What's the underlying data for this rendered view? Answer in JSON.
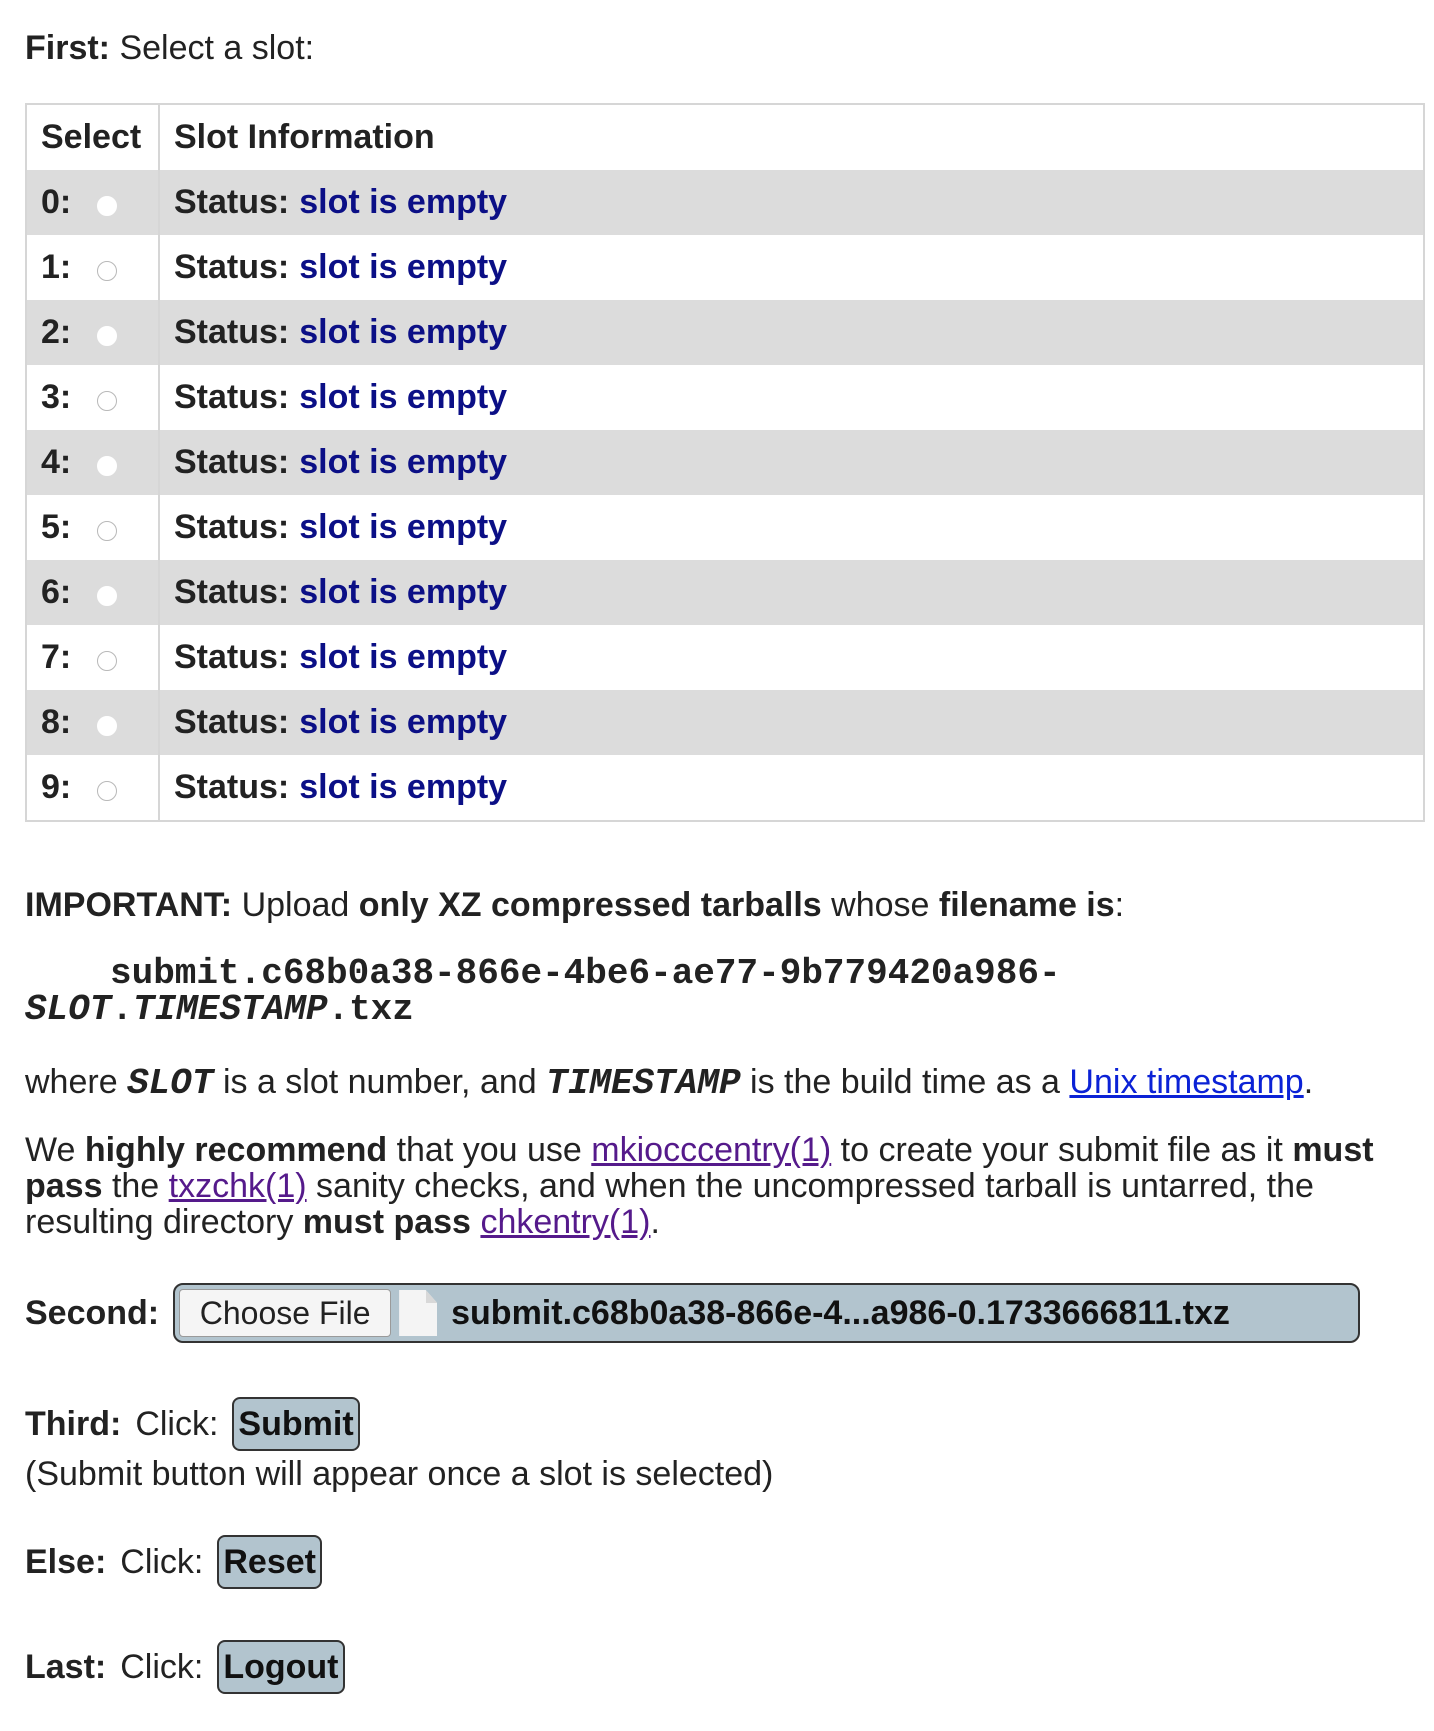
{
  "first": {
    "label": "First:",
    "text": "Select a slot:"
  },
  "table": {
    "headers": [
      "Select",
      "Slot Information"
    ],
    "status_label": "Status:",
    "rows": [
      {
        "num": "0:",
        "status": "slot is empty",
        "selected": true
      },
      {
        "num": "1:",
        "status": "slot is empty",
        "selected": false
      },
      {
        "num": "2:",
        "status": "slot is empty",
        "selected": false
      },
      {
        "num": "3:",
        "status": "slot is empty",
        "selected": false
      },
      {
        "num": "4:",
        "status": "slot is empty",
        "selected": false
      },
      {
        "num": "5:",
        "status": "slot is empty",
        "selected": false
      },
      {
        "num": "6:",
        "status": "slot is empty",
        "selected": false
      },
      {
        "num": "7:",
        "status": "slot is empty",
        "selected": false
      },
      {
        "num": "8:",
        "status": "slot is empty",
        "selected": false
      },
      {
        "num": "9:",
        "status": "slot is empty",
        "selected": false
      }
    ]
  },
  "important": {
    "label": "IMPORTANT:",
    "t1": "Upload",
    "b1": "only XZ compressed tarballs",
    "t2": "whose",
    "b2": "filename is",
    "t3": ":"
  },
  "filename": {
    "line1": "submit.c68b0a38-866e-4be6-ae77-9b779420a986-",
    "slot": "SLOT",
    "dot": ".",
    "timestamp": "TIMESTAMP",
    "ext": ".txz"
  },
  "where": {
    "t1": "where",
    "slot": "SLOT",
    "t2": "is a slot number, and",
    "timestamp": "TIMESTAMP",
    "t3": "is the build time as a",
    "link": "Unix timestamp",
    "t4": "."
  },
  "recommend": {
    "t1": "We",
    "b1": "highly recommend",
    "t2": "that you use",
    "link1": "mkiocccentry(1)",
    "t3": "to create your submit file as it",
    "b2": "must pass",
    "t4": "the",
    "link2": "txzchk(1)",
    "t5": "sanity checks, and when the uncompressed tarball is untarred, the resulting directory",
    "b3": "must pass",
    "link3": "chkentry(1)",
    "t6": "."
  },
  "second": {
    "label": "Second:",
    "choose_label": "Choose File",
    "file_name": "submit.c68b0a38-866e-4...a986-0.1733666811.txz"
  },
  "third": {
    "label": "Third:",
    "text": "Click:",
    "button": "Submit",
    "note": "(Submit button will appear once a slot is selected)"
  },
  "else": {
    "label": "Else:",
    "text": "Click:",
    "button": "Reset"
  },
  "last": {
    "label": "Last:",
    "text": "Click:",
    "button": "Logout"
  }
}
